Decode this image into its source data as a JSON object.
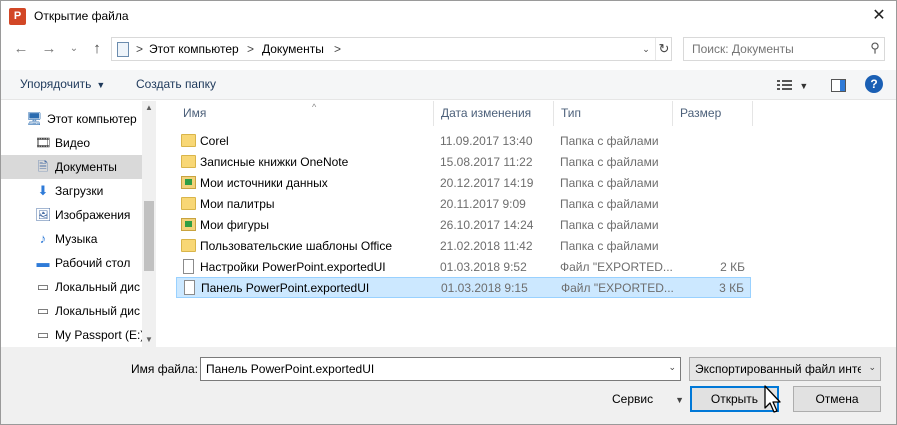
{
  "window": {
    "title": "Открытие файла",
    "app_icon_letter": "P",
    "close_glyph": "✕"
  },
  "nav": {
    "back_glyph": "←",
    "forward_glyph": "→",
    "recent_glyph": "⌄",
    "up_glyph": "↑",
    "breadcrumb": [
      "Этот компьютер",
      "Документы"
    ],
    "separator": ">",
    "refresh_glyph": "↻",
    "search_placeholder": "Поиск: Документы",
    "search_glyph": "⚲"
  },
  "toolbar": {
    "organize_label": "Упорядочить",
    "new_folder_label": "Создать папку",
    "dropdown_glyph": "▼",
    "help_glyph": "?"
  },
  "sidebar": {
    "items": [
      {
        "label": "Этот компьютер",
        "icon": "computer-icon",
        "glyph": "🖥",
        "color": "#2b6cb0",
        "selected": false
      },
      {
        "label": "Видео",
        "icon": "video-icon",
        "glyph": "🎞",
        "color": "#3b3b3b",
        "selected": false
      },
      {
        "label": "Документы",
        "icon": "documents-icon",
        "glyph": "🗎",
        "color": "#4a6fa5",
        "selected": true
      },
      {
        "label": "Загрузки",
        "icon": "downloads-icon",
        "glyph": "⬇",
        "color": "#2f7bd8",
        "selected": false
      },
      {
        "label": "Изображения",
        "icon": "pictures-icon",
        "glyph": "🖼",
        "color": "#4a6fa5",
        "selected": false
      },
      {
        "label": "Музыка",
        "icon": "music-icon",
        "glyph": "♪",
        "color": "#2f7bd8",
        "selected": false
      },
      {
        "label": "Рабочий стол",
        "icon": "desktop-icon",
        "glyph": "▬",
        "color": "#2f7bd8",
        "selected": false
      },
      {
        "label": "Локальный дис",
        "icon": "drive-icon",
        "glyph": "▭",
        "color": "#555555",
        "selected": false
      },
      {
        "label": "Локальный дис",
        "icon": "drive-icon",
        "glyph": "▭",
        "color": "#555555",
        "selected": false
      },
      {
        "label": "My Passport (E:)",
        "icon": "drive-icon",
        "glyph": "▭",
        "color": "#555555",
        "selected": false
      }
    ],
    "scroll_up": "▲",
    "scroll_down": "▼"
  },
  "filelist": {
    "columns": [
      "Имя",
      "Дата изменения",
      "Тип",
      "Размер"
    ],
    "sort_glyph": "^",
    "rows": [
      {
        "name": "Corel",
        "date": "11.09.2017 13:40",
        "type": "Папка с файлами",
        "size": "",
        "kind": "folder",
        "selected": false
      },
      {
        "name": "Записные книжки OneNote",
        "date": "15.08.2017 11:22",
        "type": "Папка с файлами",
        "size": "",
        "kind": "folder",
        "selected": false
      },
      {
        "name": "Мои источники данных",
        "date": "20.12.2017 14:19",
        "type": "Папка с файлами",
        "size": "",
        "kind": "special",
        "selected": false
      },
      {
        "name": "Мои палитры",
        "date": "20.11.2017 9:09",
        "type": "Папка с файлами",
        "size": "",
        "kind": "folder",
        "selected": false
      },
      {
        "name": "Мои фигуры",
        "date": "26.10.2017 14:24",
        "type": "Папка с файлами",
        "size": "",
        "kind": "special",
        "selected": false
      },
      {
        "name": "Пользовательские шаблоны Office",
        "date": "21.02.2018 11:42",
        "type": "Папка с файлами",
        "size": "",
        "kind": "folder",
        "selected": false
      },
      {
        "name": "Настройки PowerPoint.exportedUI",
        "date": "01.03.2018 9:52",
        "type": "Файл \"EXPORTED...",
        "size": "2 КБ",
        "kind": "file",
        "selected": false
      },
      {
        "name": "Панель PowerPoint.exportedUI",
        "date": "01.03.2018 9:15",
        "type": "Файл \"EXPORTED...",
        "size": "3 КБ",
        "kind": "file",
        "selected": true
      }
    ]
  },
  "footer": {
    "filename_label": "Имя файла:",
    "filename_value": "Панель PowerPoint.exportedUI",
    "filter_value": "Экспортированный файл инте",
    "tools_label": "Сервис",
    "open_label": "Открыть",
    "cancel_label": "Отмена",
    "dropdown_glyph": "▼",
    "chevron_glyph": "⌄"
  },
  "colors": {
    "accent": "#0078d7",
    "selection": "#cce8ff"
  }
}
